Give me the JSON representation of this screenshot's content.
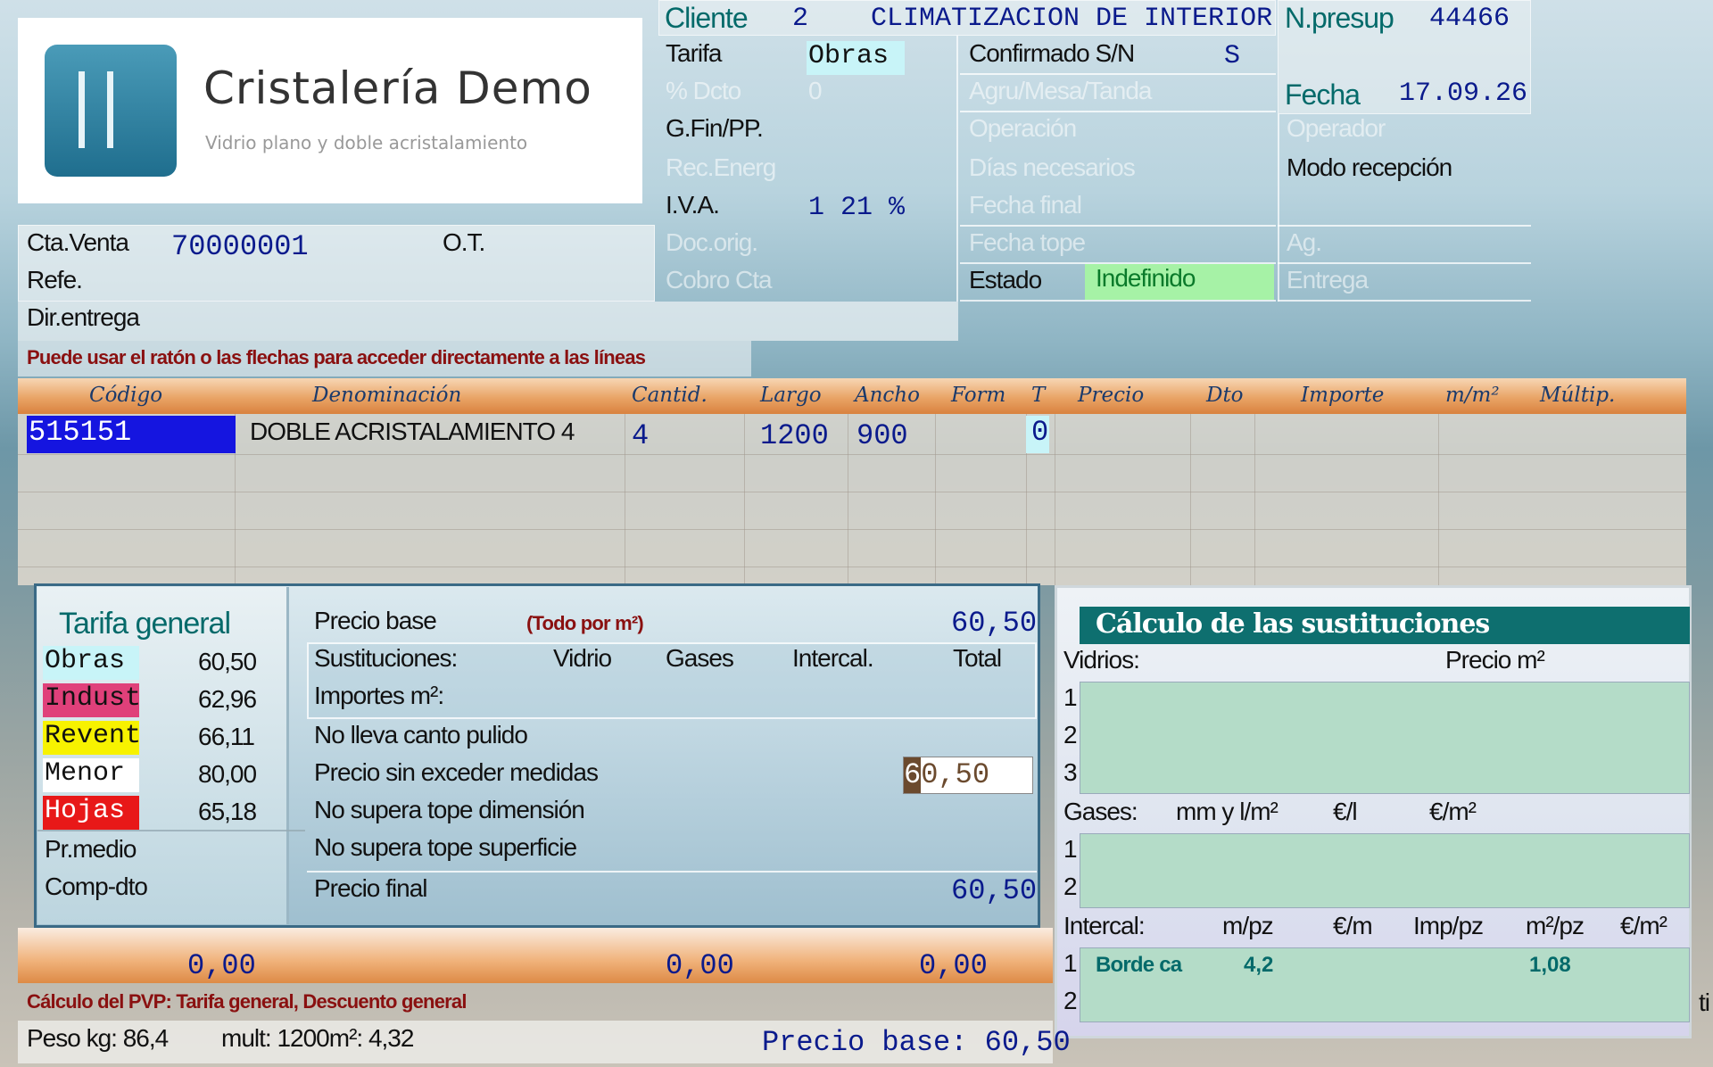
{
  "logo": {
    "company": "Cristalería Demo",
    "tagline": "Vidrio plano y doble acristalamiento"
  },
  "header": {
    "cliente_label": "Cliente",
    "cliente_num": "2",
    "cliente_name": "CLIMATIZACION DE INTERIOR",
    "npresup_label": "N.presup",
    "npresup_value": "44466",
    "fecha_label": "Fecha",
    "fecha_value": "17.09.26",
    "tarifa_label": "Tarifa",
    "tarifa_value": "Obras",
    "dcto_label": "% Dcto",
    "dcto_value": "0",
    "gfin_label": "G.Fin/PP.",
    "recenerg_label": "Rec.Energ",
    "iva_label": "I.V.A.",
    "iva_value": "1 21 %",
    "docorig_label": "Doc.orig.",
    "cobro_label": "Cobro Cta",
    "confirmado_label": "Confirmado S/N",
    "confirmado_value": "S",
    "agru_label": "Agru/Mesa/Tanda",
    "operacion_label": "Operación",
    "dias_label": "Días necesarios",
    "fechafinal_label": "Fecha final",
    "fechatope_label": "Fecha tope",
    "estado_label": "Estado",
    "estado_value": "Indefinido",
    "operador_label": "Operador",
    "modo_label": "Modo recepción",
    "ag_label": "Ag.",
    "entrega_label": "Entrega",
    "ctaventa_label": "Cta.Venta",
    "ctaventa_value": "70000001",
    "ot_label": "O.T.",
    "refe_label": "Refe.",
    "direntrega_label": "Dir.entrega",
    "hint": "Puede usar el ratón o las flechas para acceder directamente a las líneas"
  },
  "grid": {
    "columns": [
      "Código",
      "Denominación",
      "Cantid.",
      "Largo",
      "Ancho",
      "Form",
      "T",
      "Precio",
      "Dto",
      "Importe",
      "m/m²",
      "Múltip."
    ],
    "row1": {
      "codigo": "515151",
      "denominacion": "DOBLE ACRISTALAMIENTO 4",
      "cantid": "4",
      "largo": "1200",
      "ancho": "900",
      "t": "0"
    }
  },
  "tarifa_panel": {
    "title": "Tarifa general",
    "items": [
      {
        "name": "Obras",
        "value": "60,50",
        "color": "#c8f4f8",
        "fg": "#111"
      },
      {
        "name": "Indust",
        "value": "62,96",
        "color": "#e0407a",
        "fg": "#111"
      },
      {
        "name": "Revent",
        "value": "66,11",
        "color": "#f7f200",
        "fg": "#111"
      },
      {
        "name": "Menor",
        "value": "80,00",
        "color": "#ffffff",
        "fg": "#111"
      },
      {
        "name": "Hojas",
        "value": "65,18",
        "color": "#e81818",
        "fg": "#ffffff"
      }
    ],
    "prmedio_label": "Pr.medio",
    "compdto_label": "Comp-dto"
  },
  "precio_panel": {
    "precio_base_label": "Precio base",
    "todo_m2": "(Todo por m²)",
    "precio_base_value": "60,50",
    "sustituciones_label": "Sustituciones:",
    "vidrio": "Vidrio",
    "gases": "Gases",
    "intercal": "Intercal.",
    "total": "Total",
    "importes_label": "Importes m²:",
    "canto_label": "No lleva canto pulido",
    "sin_exceder_label": "Precio sin exceder medidas",
    "sin_exceder_value": "60,50",
    "sin_exceder_cursor": "6",
    "sin_exceder_rest": "0,50",
    "tope_dim_label": "No supera tope dimensión",
    "tope_sup_label": "No supera tope superficie",
    "precio_final_label": "Precio final",
    "precio_final_value": "60,50"
  },
  "calc_panel": {
    "title": "Cálculo de las sustituciones",
    "vidrios_label": "Vidrios:",
    "precio_m2_label": "Precio m²",
    "rows_vidrios": [
      "1",
      "2",
      "3"
    ],
    "gases_label": "Gases:",
    "gases_cols": [
      "mm y l/m²",
      "€/l",
      "€/m²"
    ],
    "rows_gases": [
      "1",
      "2"
    ],
    "intercal_label": "Intercal:",
    "intercal_cols": [
      "m/pz",
      "€/m",
      "Imp/pz",
      "m²/pz",
      "€/m²"
    ],
    "intercal_row1": {
      "num": "1",
      "name": "Borde ca",
      "mpz": "4,2",
      "m2pz": "1,08"
    },
    "intercal_row2": {
      "num": "2"
    }
  },
  "footer": {
    "total1": "0,00",
    "total2": "0,00",
    "total3": "0,00",
    "calc_pvp": "Cálculo del PVP: Tarifa general, Descuento general",
    "peso": "Peso kg: 86,4",
    "mult": "mult: 1200m²: 4,32",
    "precio_base": "Precio base: 60,50",
    "edge_text": "ti"
  }
}
